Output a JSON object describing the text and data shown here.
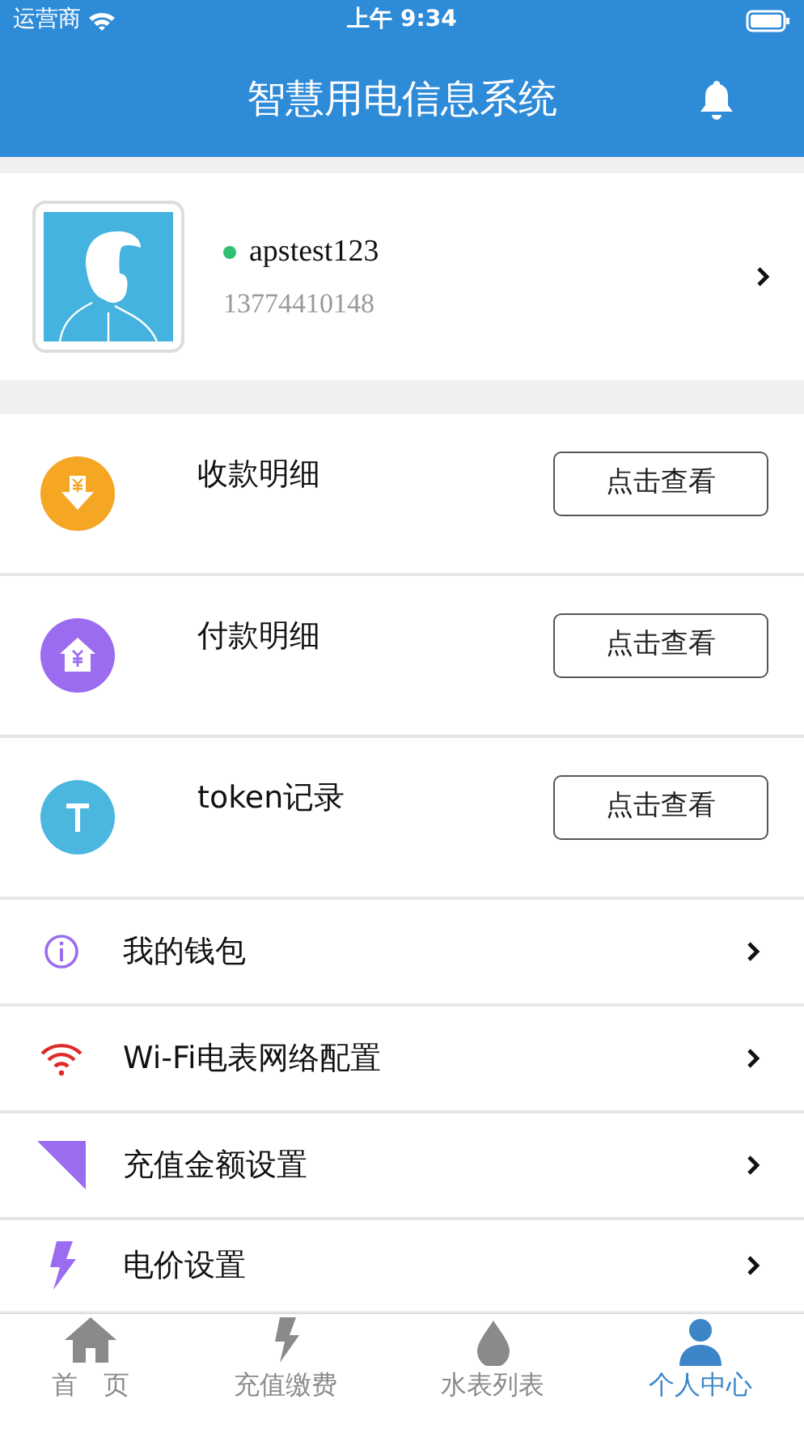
{
  "status_bar": {
    "carrier": "运营商",
    "time": "上午 9:34"
  },
  "header": {
    "title": "智慧用电信息系统"
  },
  "profile": {
    "username": "apstest123",
    "online": true,
    "phone": "13774410148"
  },
  "records": [
    {
      "label": "收款明细",
      "button": "点击查看"
    },
    {
      "label": "付款明细",
      "button": "点击查看"
    },
    {
      "label": "token记录",
      "button": "点击查看"
    }
  ],
  "menu": [
    {
      "label": "我的钱包"
    },
    {
      "label": "Wi-Fi电表网络配置"
    },
    {
      "label": "充值金额设置"
    },
    {
      "label": "电价设置"
    }
  ],
  "tab_bar": [
    {
      "label": "首　页",
      "selected": false
    },
    {
      "label": "充值缴费",
      "selected": false
    },
    {
      "label": "水表列表",
      "selected": false
    },
    {
      "label": "个人中心",
      "selected": true
    }
  ]
}
